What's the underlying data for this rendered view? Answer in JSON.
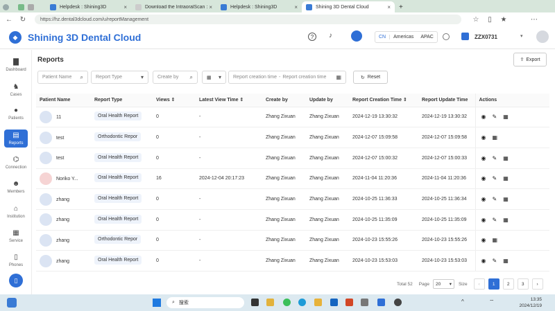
{
  "browser": {
    "tabs": [
      "Helpdesk : Shining3D",
      "Download the IntraoralScan : Den",
      "Helpdesk : Shining3D",
      "Shining 3D Dental Cloud"
    ],
    "url": "https://hz.dental3dcloud.com/u/reportManagement"
  },
  "header": {
    "brand": "Shining 3D Dental Cloud",
    "regions": [
      "CN",
      "Americas",
      "APAC"
    ],
    "user": "ZZX0731"
  },
  "sidebar": {
    "items": [
      {
        "label": "Dashboard",
        "icon": "bar-chart-icon"
      },
      {
        "label": "Cases",
        "icon": "tooth-icon"
      },
      {
        "label": "Patients",
        "icon": "person-icon"
      },
      {
        "label": "Reports",
        "icon": "report-icon"
      },
      {
        "label": "Connection",
        "icon": "connection-icon"
      },
      {
        "label": "Members",
        "icon": "members-icon"
      },
      {
        "label": "Institution",
        "icon": "institution-icon"
      },
      {
        "label": "Service",
        "icon": "service-icon"
      },
      {
        "label": "Phones",
        "icon": "phone-icon"
      }
    ]
  },
  "page": {
    "title": "Reports",
    "export_label": "Export",
    "reset_label": "Reset"
  },
  "filters": {
    "patient_name": "Patient Name",
    "report_type": "Report Type",
    "create_by": "Create by",
    "creation_time_start": "Report creation time",
    "creation_time_end": "Report creation time"
  },
  "table": {
    "columns": [
      "Patient Name",
      "Report Type",
      "Views",
      "Latest View Time",
      "Create by",
      "Update by",
      "Report Creation Time",
      "Report Update Time",
      "Actions"
    ],
    "rows": [
      {
        "patient": "11",
        "type": "Oral Health Report",
        "views": "0",
        "latest": "-",
        "create_by": "Zhang Zixuan",
        "update_by": "Zhang Zixuan",
        "created": "2024-12-19 13:30:32",
        "updated": "2024-12-19 13:30:32"
      },
      {
        "patient": "test",
        "type": "Orthodontic Repor",
        "views": "0",
        "latest": "-",
        "create_by": "Zhang Zixuan",
        "update_by": "Zhang Zixuan",
        "created": "2024-12-07 15:09:58",
        "updated": "2024-12-07 15:09:58"
      },
      {
        "patient": "test",
        "type": "Oral Health Report",
        "views": "0",
        "latest": "-",
        "create_by": "Zhang Zixuan",
        "update_by": "Zhang Zixuan",
        "created": "2024-12-07 15:00:32",
        "updated": "2024-12-07 15:00:33"
      },
      {
        "patient": "Noriko Y...",
        "type": "Oral Health Report",
        "views": "16",
        "latest": "2024-12-04 20:17:23",
        "create_by": "Zhang Zixuan",
        "update_by": "Zhang Zixuan",
        "created": "2024-11-04 11:20:36",
        "updated": "2024-11-04 11:20:36"
      },
      {
        "patient": "zhang",
        "type": "Oral Health Report",
        "views": "0",
        "latest": "-",
        "create_by": "Zhang Zixuan",
        "update_by": "Zhang Zixuan",
        "created": "2024-10-25 11:36:33",
        "updated": "2024-10-25 11:36:34"
      },
      {
        "patient": "zhang",
        "type": "Oral Health Report",
        "views": "0",
        "latest": "-",
        "create_by": "Zhang Zixuan",
        "update_by": "Zhang Zixuan",
        "created": "2024-10-25 11:35:09",
        "updated": "2024-10-25 11:35:09"
      },
      {
        "patient": "zhang",
        "type": "Orthodontic Repor",
        "views": "0",
        "latest": "-",
        "create_by": "Zhang Zixuan",
        "update_by": "Zhang Zixuan",
        "created": "2024-10-23 15:55:26",
        "updated": "2024-10-23 15:55:26"
      },
      {
        "patient": "zhang",
        "type": "Oral Health Report",
        "views": "0",
        "latest": "-",
        "create_by": "Zhang Zixuan",
        "update_by": "Zhang Zixuan",
        "created": "2024-10-23 15:53:03",
        "updated": "2024-10-23 15:53:03"
      }
    ]
  },
  "pagination": {
    "total": "Total 52",
    "page_label": "Page",
    "page_size": "20",
    "size_label": "Size",
    "pages": [
      "1",
      "2",
      "3"
    ]
  },
  "taskbar": {
    "search": "搜索",
    "time": "13:35",
    "date": "2024/12/19"
  }
}
